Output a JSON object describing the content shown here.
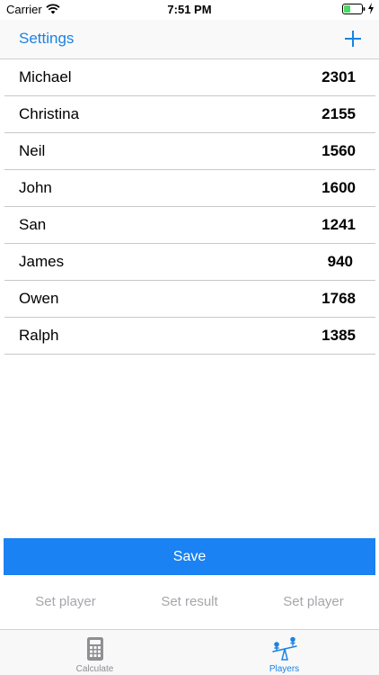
{
  "status_bar": {
    "carrier": "Carrier",
    "time": "7:51 PM"
  },
  "nav": {
    "title_left": "Settings",
    "add_icon": "plus-icon",
    "accent_color": "#1a82e2"
  },
  "players": [
    {
      "name": "Michael",
      "rating": "2301"
    },
    {
      "name": "Christina",
      "rating": "2155"
    },
    {
      "name": "Neil",
      "rating": "1560"
    },
    {
      "name": "John",
      "rating": "1600"
    },
    {
      "name": "San",
      "rating": "1241"
    },
    {
      "name": "James",
      "rating": "940"
    },
    {
      "name": "Owen",
      "rating": "1768"
    },
    {
      "name": "Ralph",
      "rating": "1385"
    }
  ],
  "save_button": {
    "label": "Save",
    "color": "#1a82f2"
  },
  "actions": [
    {
      "label": "Set player"
    },
    {
      "label": "Set result"
    },
    {
      "label": "Set player"
    }
  ],
  "tabs": [
    {
      "label": "Calculate",
      "icon": "calculator-icon",
      "selected": false
    },
    {
      "label": "Players",
      "icon": "seesaw-icon",
      "selected": true
    }
  ]
}
